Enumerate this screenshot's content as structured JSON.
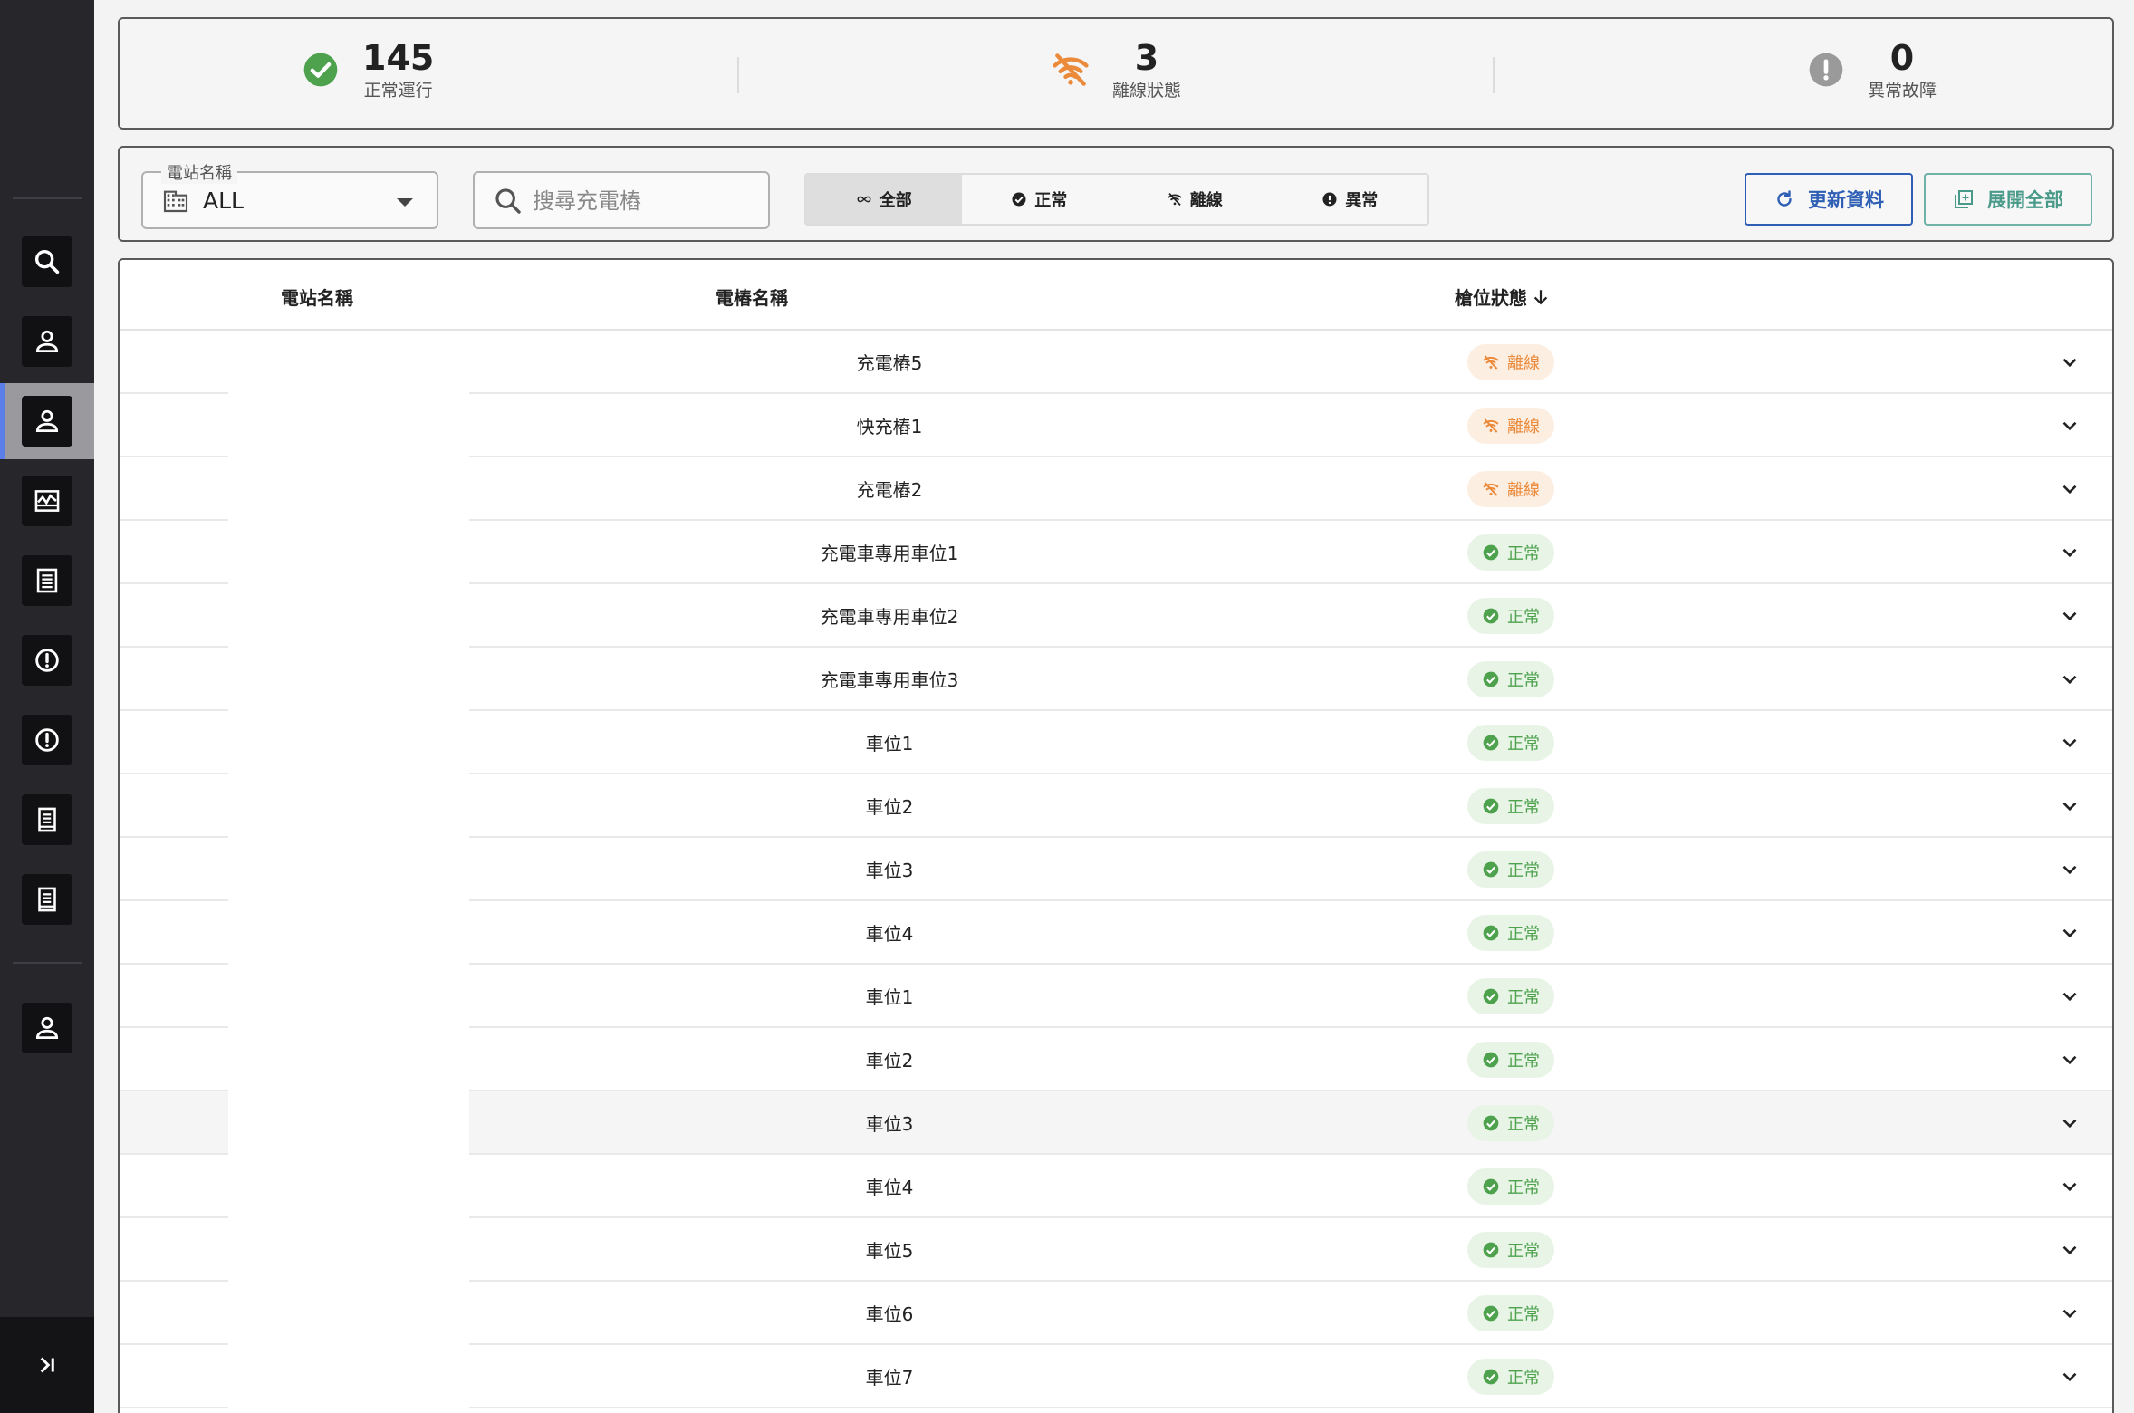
{
  "summary": {
    "normal": {
      "count": "145",
      "label": "正常運行"
    },
    "offline": {
      "count": "3",
      "label": "離線狀態"
    },
    "fault": {
      "count": "0",
      "label": "異常故障"
    }
  },
  "filters": {
    "station_label": "電站名稱",
    "station_value": "ALL",
    "search_placeholder": "搜尋充電樁",
    "segments": [
      {
        "label": "全部",
        "icon": "infinity-icon",
        "active": true
      },
      {
        "label": "正常",
        "icon": "check-circle-icon",
        "active": false
      },
      {
        "label": "離線",
        "icon": "wifi-off-icon",
        "active": false
      },
      {
        "label": "異常",
        "icon": "alert-circle-icon",
        "active": false
      }
    ],
    "refresh_label": "更新資料",
    "expand_label": "展開全部"
  },
  "table": {
    "headers": {
      "station": "電站名稱",
      "charger": "電樁名稱",
      "status": "槍位狀態"
    },
    "rows": [
      {
        "name": "充電樁5",
        "status": "離線",
        "type": "offline"
      },
      {
        "name": "快充樁1",
        "status": "離線",
        "type": "offline"
      },
      {
        "name": "充電樁2",
        "status": "離線",
        "type": "offline"
      },
      {
        "name": "充電車專用車位1",
        "status": "正常",
        "type": "ok"
      },
      {
        "name": "充電車專用車位2",
        "status": "正常",
        "type": "ok"
      },
      {
        "name": "充電車專用車位3",
        "status": "正常",
        "type": "ok"
      },
      {
        "name": "車位1",
        "status": "正常",
        "type": "ok"
      },
      {
        "name": "車位2",
        "status": "正常",
        "type": "ok"
      },
      {
        "name": "車位3",
        "status": "正常",
        "type": "ok"
      },
      {
        "name": "車位4",
        "status": "正常",
        "type": "ok"
      },
      {
        "name": "車位1",
        "status": "正常",
        "type": "ok"
      },
      {
        "name": "車位2",
        "status": "正常",
        "type": "ok"
      },
      {
        "name": "車位3",
        "status": "正常",
        "type": "ok",
        "hover": true
      },
      {
        "name": "車位4",
        "status": "正常",
        "type": "ok"
      },
      {
        "name": "車位5",
        "status": "正常",
        "type": "ok"
      },
      {
        "name": "車位6",
        "status": "正常",
        "type": "ok"
      },
      {
        "name": "車位7",
        "status": "正常",
        "type": "ok"
      }
    ]
  },
  "colors": {
    "sidebar": "#26262b",
    "accent": "#5b7fe8",
    "ok": "#4ea24e",
    "offline": "#ea8a3a",
    "fault": "#9a9a9a",
    "refresh": "#2f5fb4",
    "expand": "#4a9a8a"
  }
}
